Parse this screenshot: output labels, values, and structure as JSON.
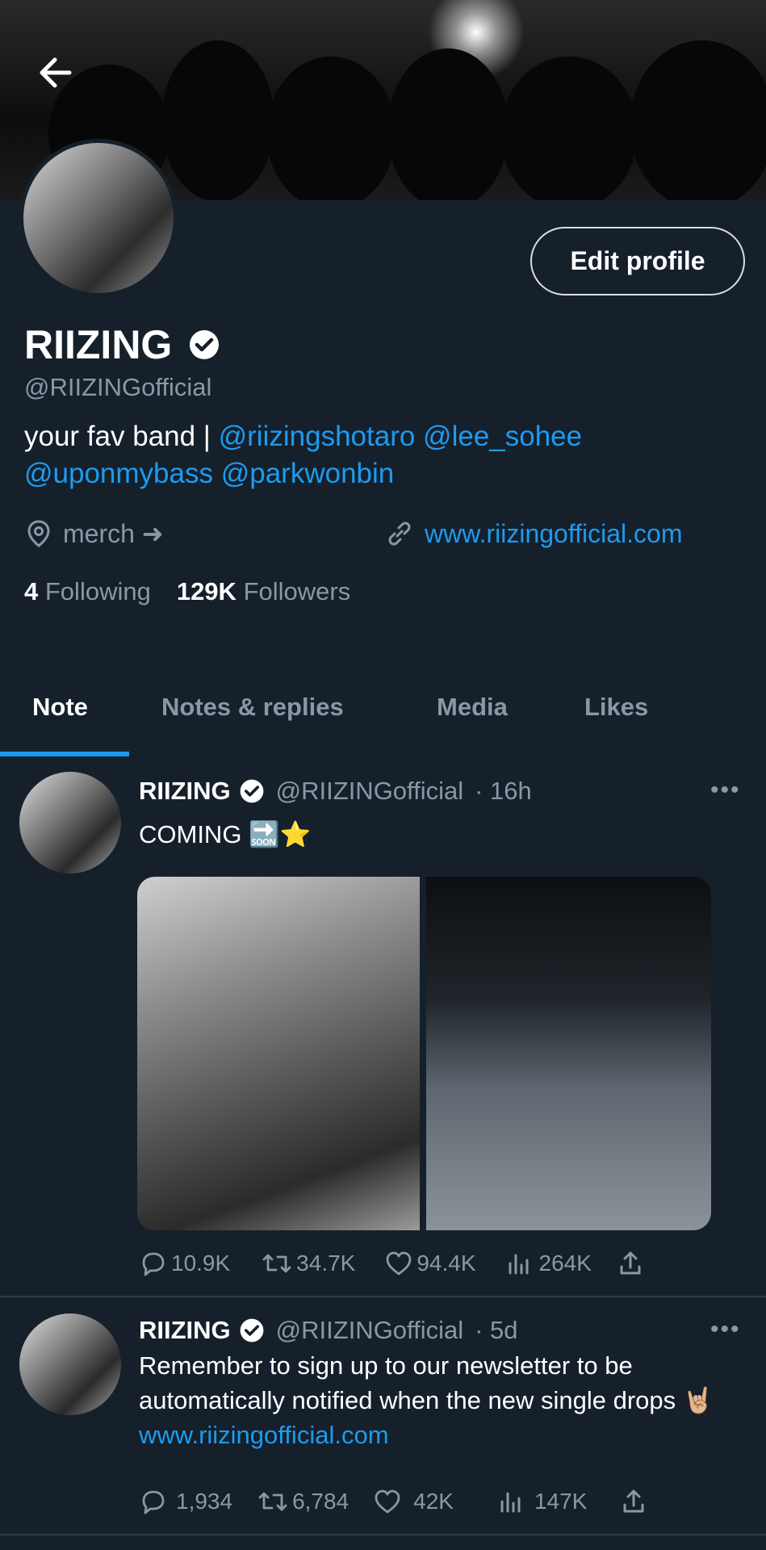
{
  "colors": {
    "background": "#15202b",
    "accent": "#1d9bf0",
    "muted": "#8899a6"
  },
  "profile": {
    "edit_label": "Edit profile",
    "name": "RIIZING",
    "handle": "@RIIZINGofficial",
    "bio_text": "your fav band | ",
    "bio_links": [
      "@riizingshotaro",
      "@lee_sohee",
      "@uponmybass",
      "@parkwonbin"
    ],
    "location": "merch ➜",
    "website": "www.riizingofficial.com",
    "following_count": "4",
    "following_label": "Following",
    "followers_count": "129K",
    "followers_label": "Followers"
  },
  "tabs": [
    {
      "label": "Note",
      "active": true
    },
    {
      "label": "Notes & replies",
      "active": false
    },
    {
      "label": "Media",
      "active": false
    },
    {
      "label": "Likes",
      "active": false
    }
  ],
  "posts": [
    {
      "name": "RIIZING",
      "handle": "@RIIZINGofficial",
      "time": "· 16h",
      "text": "COMING",
      "emoji": "🔜⭐",
      "more": "•••",
      "replies": "10.9K",
      "reposts": "34.7K",
      "likes": "94.4K",
      "views": "264K"
    },
    {
      "name": "RIIZING",
      "handle": "@RIIZINGofficial",
      "time": "· 5d",
      "text": "Remember to sign up to our newsletter to be automatically notified when the new single drops 🤘🏼",
      "link": "www.riizingofficial.com",
      "more": "•••",
      "replies": "1,934",
      "reposts": "6,784",
      "likes": "42K",
      "views": "147K"
    }
  ]
}
